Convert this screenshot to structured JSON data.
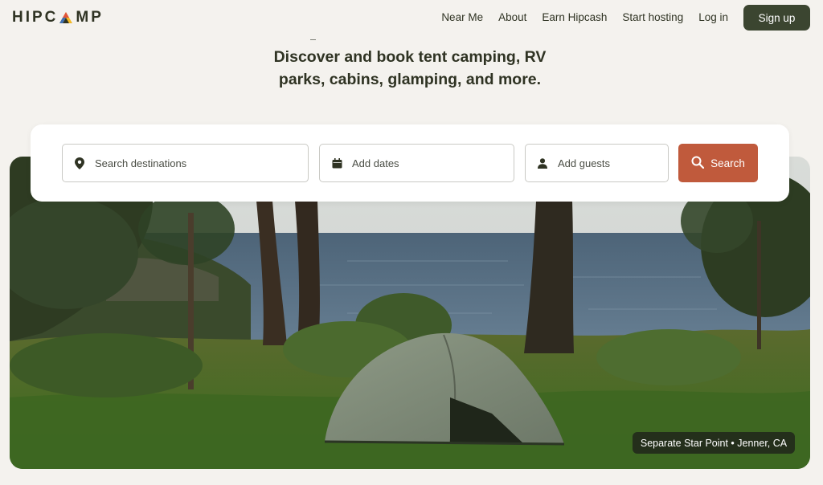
{
  "brand": {
    "logo_text_left": "HIPC",
    "logo_text_right": "MP"
  },
  "nav": {
    "links": [
      "Near Me",
      "About",
      "Earn Hipcash",
      "Start hosting",
      "Log in"
    ],
    "signup_label": "Sign up"
  },
  "hero": {
    "headline_line1": "Discover and book tent camping, RV",
    "headline_line2": "parks, cabins, glamping, and more.",
    "photo_caption": "Separate Star Point • Jenner, CA"
  },
  "search": {
    "destination_placeholder": "Search destinations",
    "dates_placeholder": "Add dates",
    "guests_placeholder": "Add guests",
    "button_label": "Search"
  },
  "colors": {
    "background": "#f4f2ee",
    "text": "#2f3323",
    "signup_bg": "#3b4530",
    "search_button": "#c05a3c"
  },
  "icons": [
    "location-pin-icon",
    "calendar-icon",
    "person-icon",
    "search-icon"
  ]
}
